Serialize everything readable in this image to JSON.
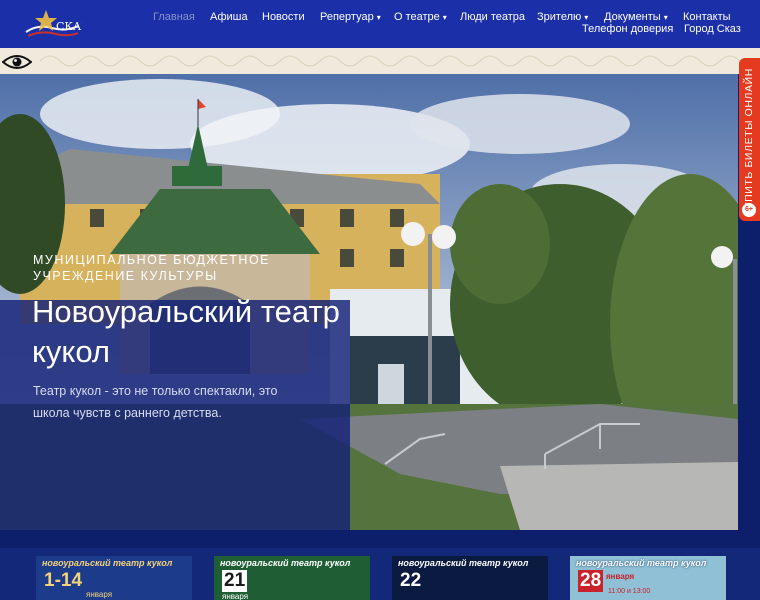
{
  "brand": {
    "logo_text": "СКАЗ"
  },
  "nav": {
    "items": [
      {
        "label": "Главная",
        "caret": ""
      },
      {
        "label": "Афиша",
        "caret": ""
      },
      {
        "label": "Новости",
        "caret": ""
      },
      {
        "label": "Репертуар",
        "caret": "▾"
      },
      {
        "label": "О театре",
        "caret": "▾"
      },
      {
        "label": "Люди театра",
        "caret": ""
      },
      {
        "label": "Зрителю",
        "caret": "▾"
      },
      {
        "label": "Документы",
        "caret": "▾"
      },
      {
        "label": "Контакты",
        "caret": ""
      }
    ],
    "row2": [
      {
        "label": "Телефон доверия"
      },
      {
        "label": "Город Сказ"
      }
    ]
  },
  "accessibility": {
    "icon": "eye-icon"
  },
  "hero": {
    "subtitle": "МУНИЦИПАЛЬНОЕ БЮДЖЕТНОЕ УЧРЕЖДЕНИЕ КУЛЬТУРЫ",
    "title": "Новоуральский театр кукол",
    "description": "Театр кукол - это не только спектакли, это школа чувств с раннего детства."
  },
  "side_tab": {
    "label": "КУПИТЬ БИЛЕТЫ ОНЛАЙН",
    "badge": "6+"
  },
  "posters": [
    {
      "brand": "новоуральский театр кукол",
      "date": "1-14",
      "month": "января",
      "time": "",
      "bg": "#1c3b8a",
      "fg": "#f3d27a"
    },
    {
      "brand": "новоуральский театр кукол",
      "date": "21",
      "month": "января",
      "time": "",
      "bg": "#1f5e35",
      "fg": "#ffffff"
    },
    {
      "brand": "новоуральский театр кукол",
      "date": "22",
      "month": "",
      "time": "",
      "bg": "#0a1a40",
      "fg": "#ffffff"
    },
    {
      "brand": "новоуральский театр кукол",
      "date": "28",
      "month": "января",
      "time": "11:00 и 13:00",
      "bg": "#8fc0d6",
      "fg": "#c9222a"
    }
  ],
  "colors": {
    "navbar": "#1a2fa8",
    "accent": "#e53a1f",
    "overlay": "#122076"
  }
}
